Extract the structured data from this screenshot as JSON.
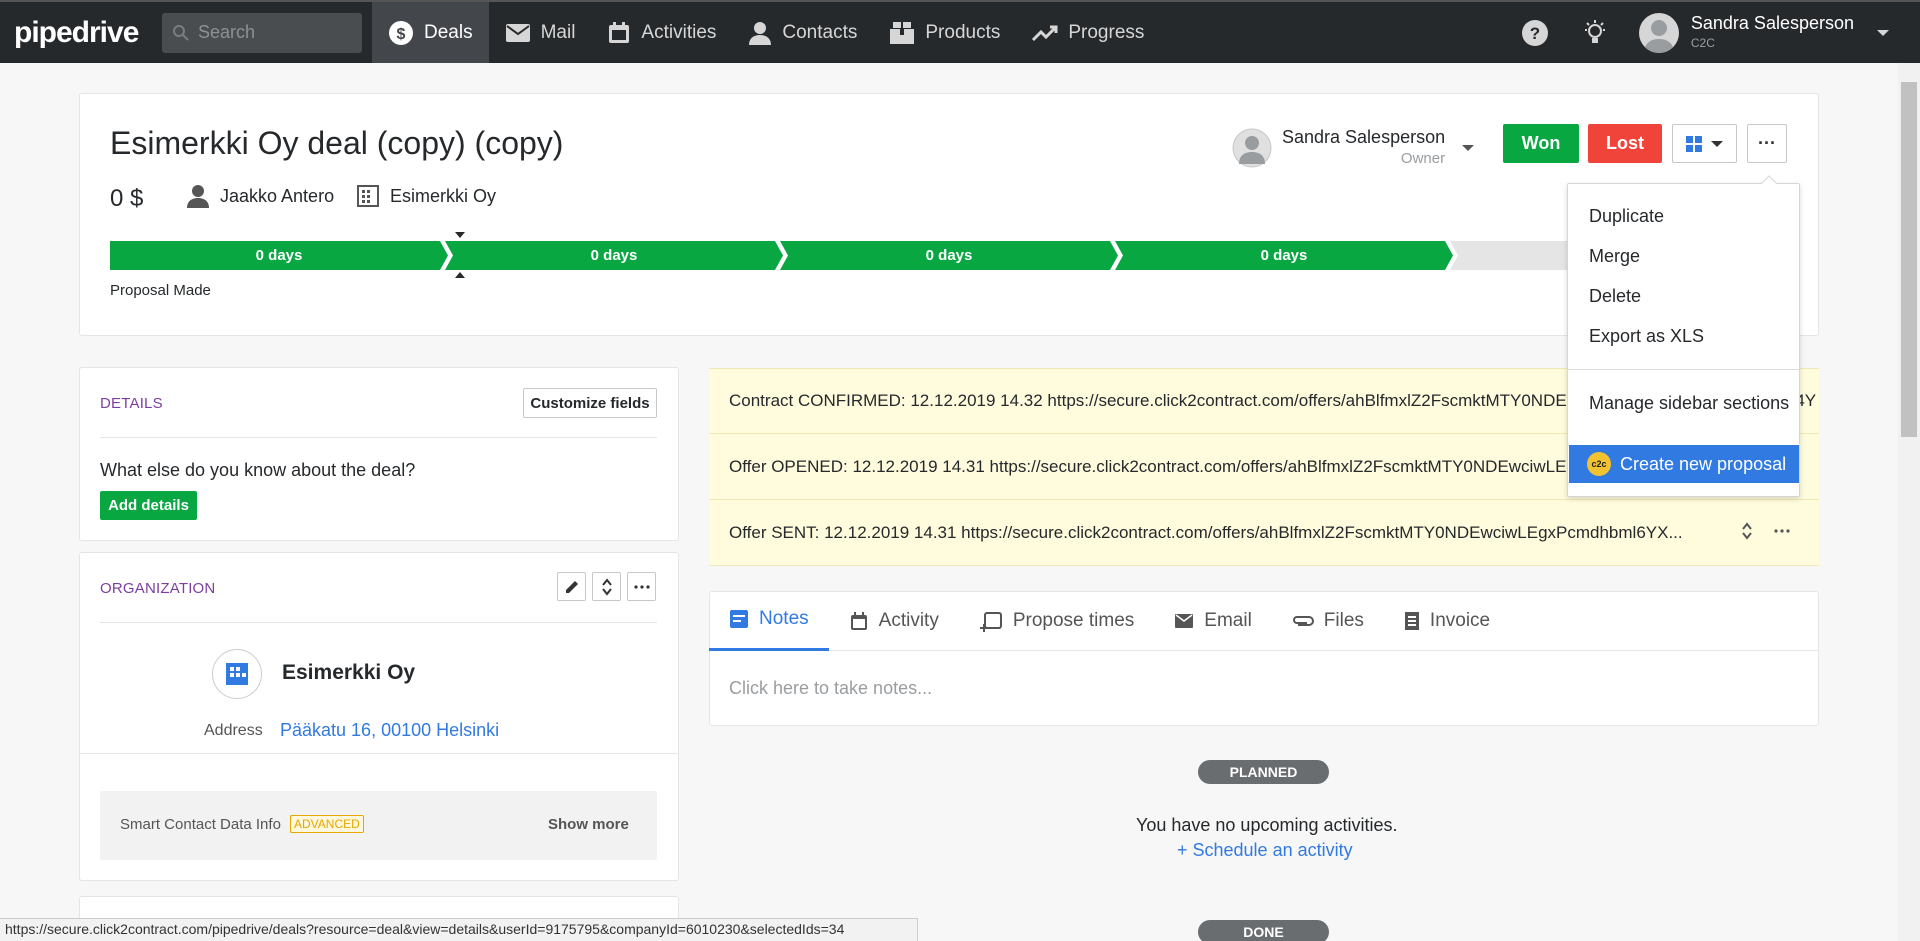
{
  "nav": {
    "logo": "pipedrive",
    "search_placeholder": "Search",
    "items": [
      {
        "label": "Deals",
        "icon": "dollar-icon"
      },
      {
        "label": "Mail",
        "icon": "mail-icon"
      },
      {
        "label": "Activities",
        "icon": "calendar-icon"
      },
      {
        "label": "Contacts",
        "icon": "person-icon"
      },
      {
        "label": "Products",
        "icon": "box-icon"
      },
      {
        "label": "Progress",
        "icon": "trend-icon"
      }
    ],
    "user_name": "Sandra Salesperson",
    "user_company": "C2C"
  },
  "deal": {
    "title": "Esimerkki Oy deal (copy) (copy)",
    "value": "0 $",
    "person": "Jaakko Antero",
    "organization": "Esimerkki Oy",
    "owner_name": "Sandra Salesperson",
    "owner_label": "Owner",
    "won_label": "Won",
    "lost_label": "Lost",
    "more_label": "···",
    "stages": [
      "0 days",
      "0 days",
      "0 days",
      "0 days"
    ],
    "current_stage": "Proposal Made"
  },
  "menu": {
    "items": [
      "Duplicate",
      "Merge",
      "Delete",
      "Export as XLS",
      "Manage sidebar sections"
    ],
    "highlight": "Create new proposal",
    "highlight_badge": "c2c"
  },
  "details": {
    "title": "DETAILS",
    "customize_label": "Customize fields",
    "prompt": "What else do you know about the deal?",
    "add_label": "Add details"
  },
  "organization": {
    "title": "ORGANIZATION",
    "name": "Esimerkki Oy",
    "address_label": "Address",
    "address": "Pääkatu 16, 00100 Helsinki",
    "smart_label": "Smart Contact Data Info",
    "smart_badge": "ADVANCED",
    "show_more": "Show more"
  },
  "feed": [
    "Contract CONFIRMED: 12.12.2019 14.32 https://secure.click2contract.com/offers/ahBlfmxlZ2FscmktMTY0NDEwciwLEgxPcmdhbml6YXRpb24Y",
    "Offer OPENED: 12.12.2019 14.31 https://secure.click2contract.com/offers/ahBlfmxlZ2FscmktMTY0NDEwciwLEgxPcmdhbml6YXRpb24Y",
    "Offer SENT: 12.12.2019 14.31 https://secure.click2contract.com/offers/ahBlfmxlZ2FscmktMTY0NDEwciwLEgxPcmdhbml6YX..."
  ],
  "tabs": [
    {
      "label": "Notes",
      "icon": "notes-icon"
    },
    {
      "label": "Activity",
      "icon": "calendar-icon"
    },
    {
      "label": "Propose times",
      "icon": "calendar-plus-icon"
    },
    {
      "label": "Email",
      "icon": "mail-icon"
    },
    {
      "label": "Files",
      "icon": "paperclip-icon"
    },
    {
      "label": "Invoice",
      "icon": "invoice-icon"
    }
  ],
  "notes_placeholder": "Click here to take notes...",
  "planned": {
    "badge": "PLANNED",
    "empty": "You have no upcoming activities.",
    "schedule": "+ Schedule an activity"
  },
  "done_badge": "DONE",
  "status_url": "https://secure.click2contract.com/pipedrive/deals?resource=deal&view=details&userId=9175795&companyId=6010230&selectedIds=34",
  "colors": {
    "won": "#08a742",
    "lost": "#f0443a",
    "stage": "#08a742",
    "accent": "#317ae2",
    "feed_bg": "#fffbdd"
  }
}
